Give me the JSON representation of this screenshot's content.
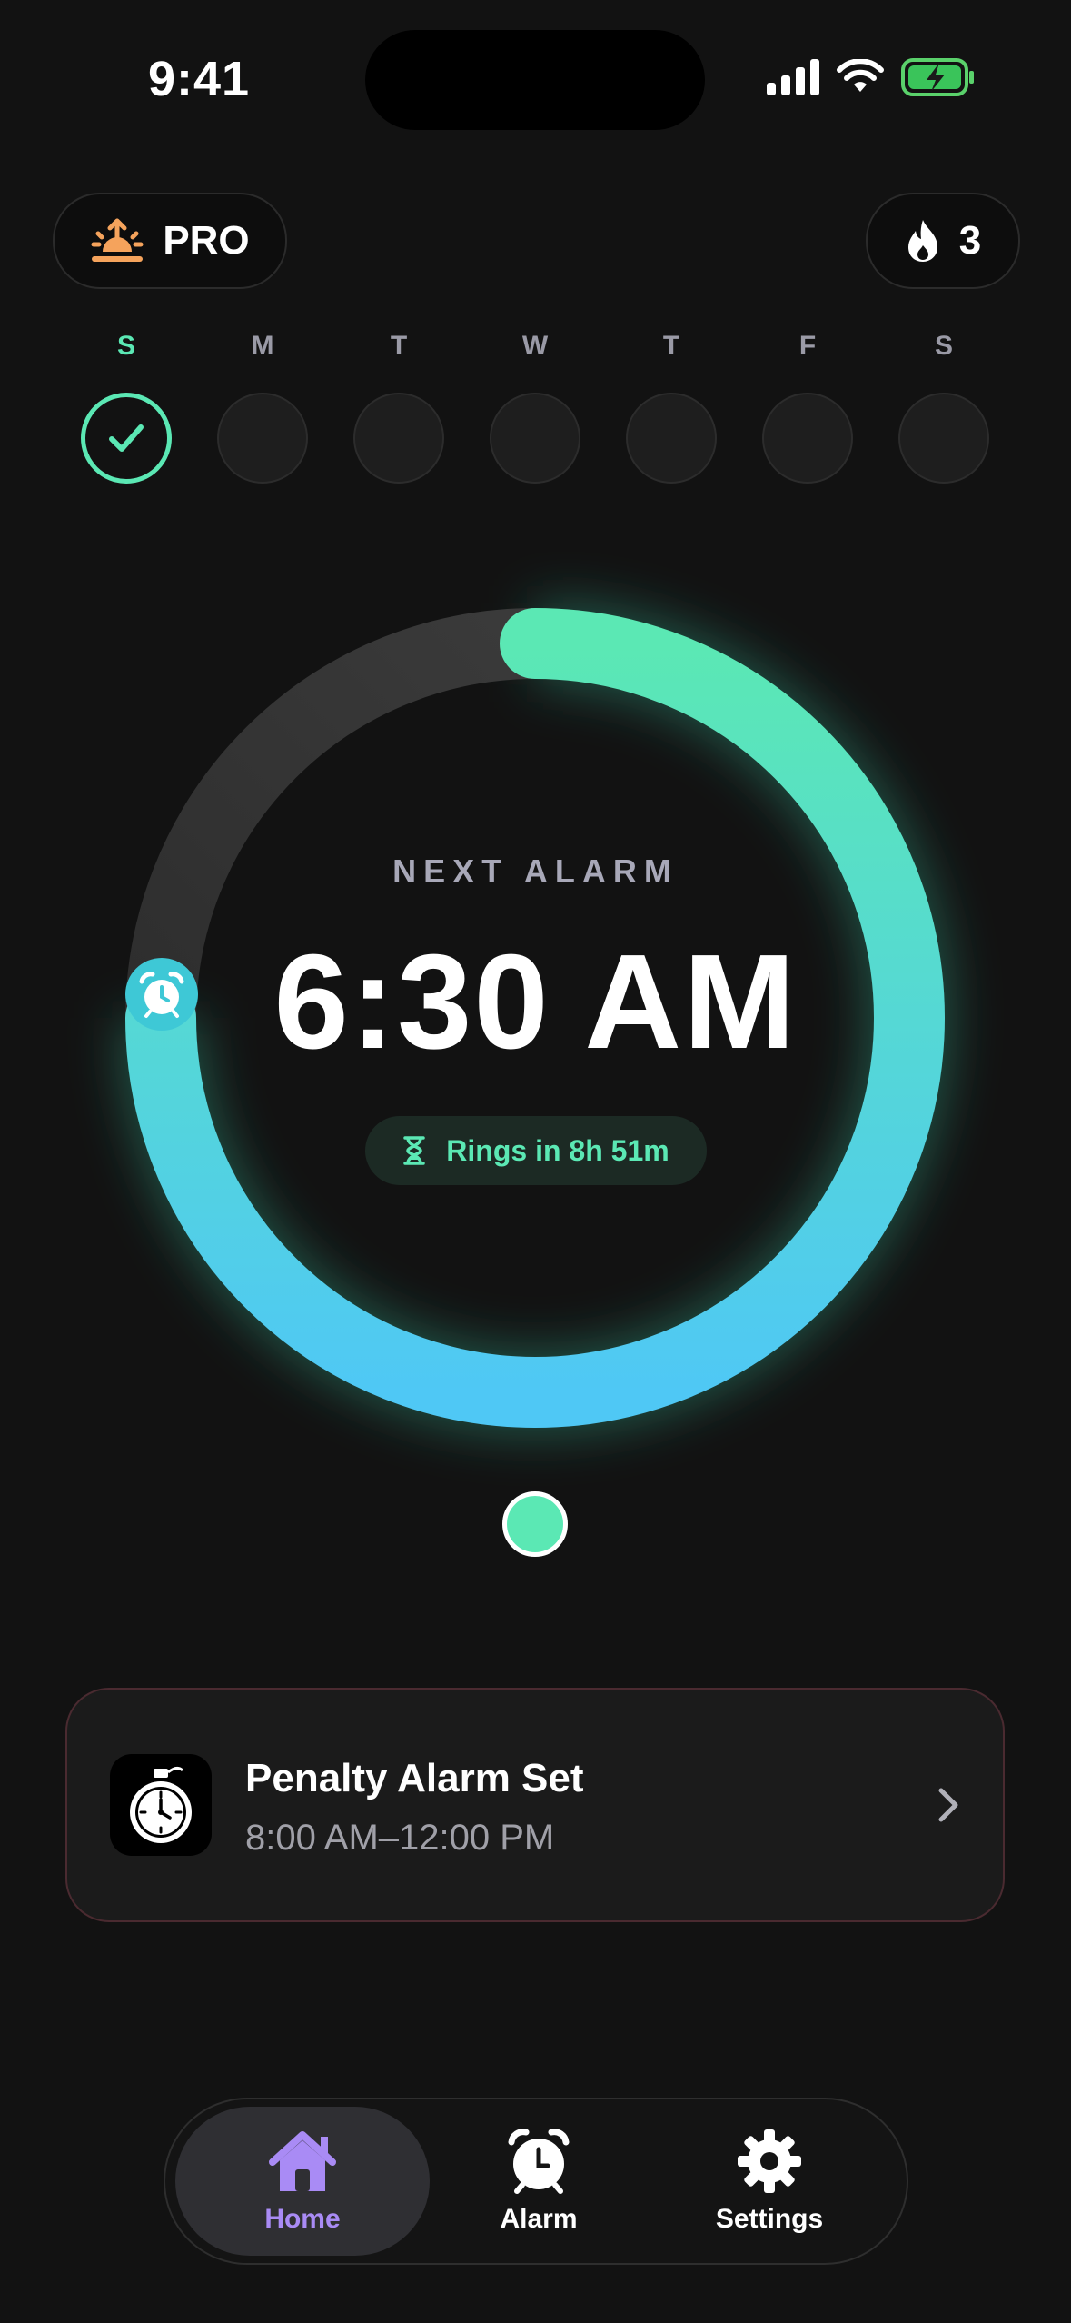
{
  "status_bar": {
    "time": "9:41"
  },
  "header": {
    "pro_label": "PRO",
    "streak_count": "3"
  },
  "weekdays": [
    {
      "label": "S",
      "done": true
    },
    {
      "label": "M",
      "done": false
    },
    {
      "label": "T",
      "done": false
    },
    {
      "label": "W",
      "done": false
    },
    {
      "label": "T",
      "done": false
    },
    {
      "label": "F",
      "done": false
    },
    {
      "label": "S",
      "done": false
    }
  ],
  "alarm": {
    "caption": "NEXT ALARM",
    "time": "6:30 AM",
    "countdown": "Rings in 8h 51m"
  },
  "penalty": {
    "title": "Penalty Alarm Set",
    "window": "8:00 AM–12:00 PM"
  },
  "tabs": [
    {
      "label": "Home",
      "active": true
    },
    {
      "label": "Alarm",
      "active": false
    },
    {
      "label": "Settings",
      "active": false
    }
  ],
  "colors": {
    "accent_green": "#5BE8B4",
    "accent_blue": "#4FC8F5",
    "accent_purple": "#A98BF5",
    "background": "#121212"
  }
}
